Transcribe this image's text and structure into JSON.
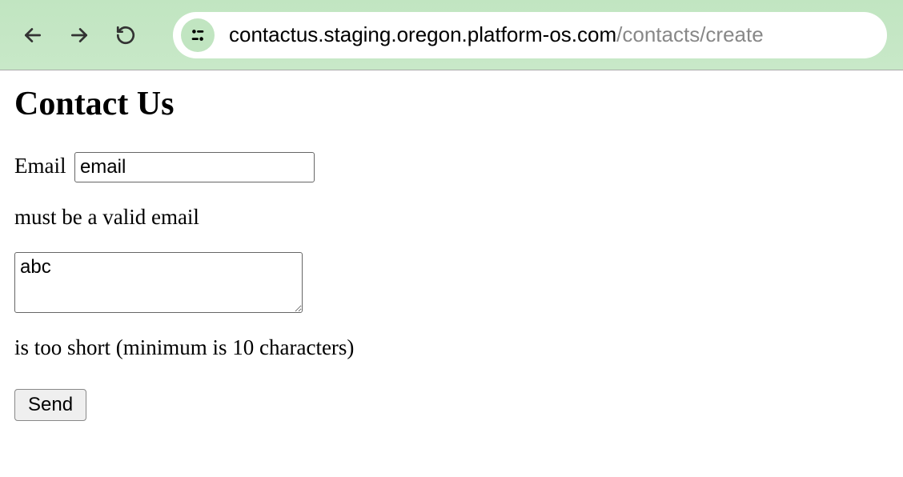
{
  "browser": {
    "url_domain": "contactus.staging.oregon.platform-os.com",
    "url_path": "/contacts/create"
  },
  "page": {
    "heading": "Contact Us"
  },
  "form": {
    "email_label": "Email",
    "email_value": "email",
    "email_error": "must be a valid email",
    "message_value": "abc",
    "message_error": "is too short (minimum is 10 characters)",
    "submit_label": "Send"
  }
}
